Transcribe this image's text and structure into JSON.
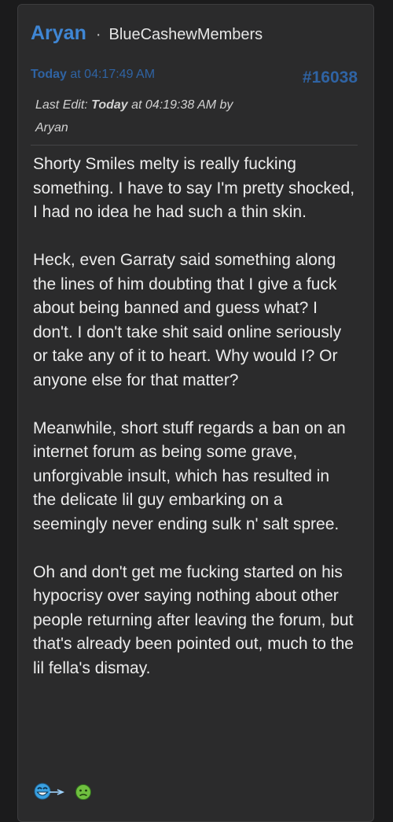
{
  "post": {
    "author": "Aryan",
    "separator": "·",
    "user_group": "BlueCashewMembers",
    "date_day": "Today",
    "date_time": "at 04:17:49 AM",
    "post_number": "#16038",
    "last_edit": {
      "label": "Last Edit:",
      "day": "Today",
      "time_by": "at 04:19:38 AM by",
      "editor": "Aryan"
    },
    "paragraphs": [
      "Shorty Smiles melty is really fucking something. I have to say I'm pretty shocked, I had no idea he had such a thin skin.",
      "Heck, even Garraty said something along the lines of him doubting that I give a fuck about being banned and guess what? I don't. I don't take shit said online seriously or take any of it to heart. Why would I? Or anyone else for that matter?",
      "Meanwhile, short stuff regards a ban on an internet forum as being some grave, unforgivable insult, which has resulted in the delicate lil guy embarking on a seemingly never ending sulk n' salt spree.",
      "Oh and don't get me fucking started on his hypocrisy over saying nothing about other people returning after leaving the forum, but that's already been pointed out, much to the lil fella's dismay."
    ],
    "emojis": [
      "laughing-emoji",
      "sick-emoji"
    ]
  },
  "colors": {
    "page_background": "#1b1b1c",
    "card_background": "#2b2b2c",
    "username": "#3f86d4",
    "meta_link": "#2f63a3",
    "body_text": "#ececec"
  }
}
